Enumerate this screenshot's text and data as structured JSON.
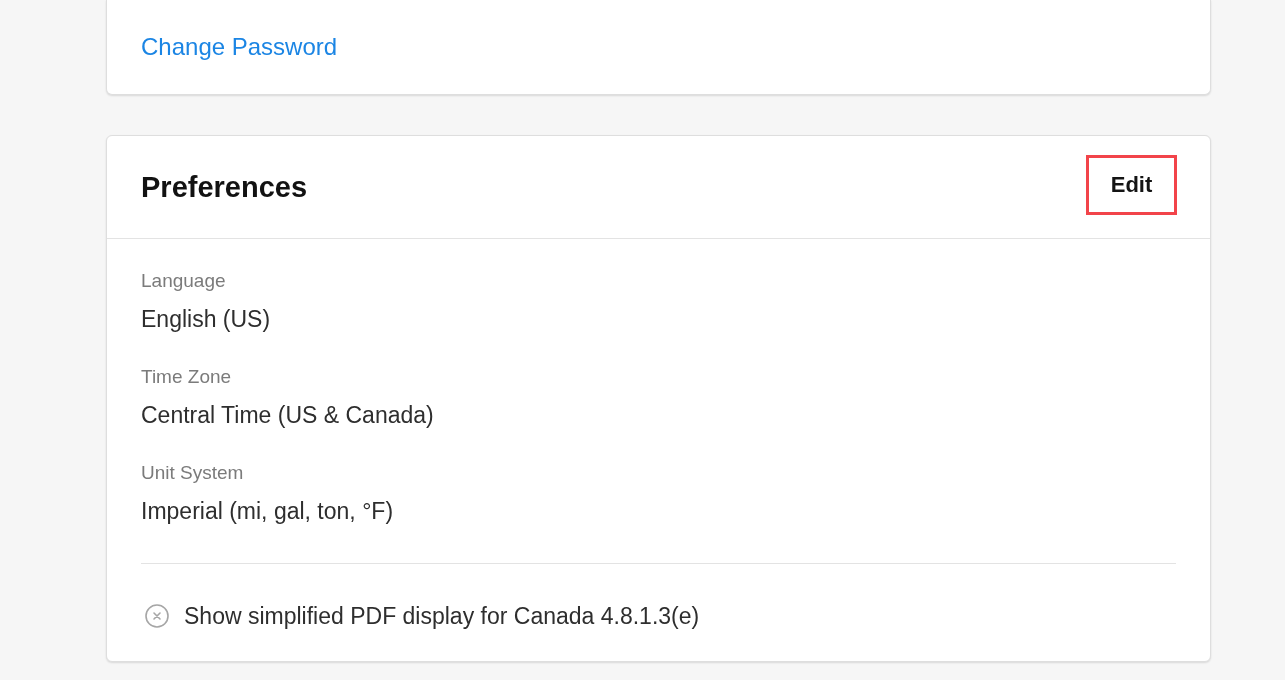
{
  "account_card": {
    "link": "Change Password"
  },
  "preferences": {
    "title": "Preferences",
    "edit_button": {
      "label": "Edit",
      "highlighted": true
    },
    "fields": [
      {
        "label": "Language",
        "value": "English (US)"
      },
      {
        "label": "Time Zone",
        "value": "Central Time (US & Canada)"
      },
      {
        "label": "Unit System",
        "value": "Imperial (mi, gal, ton, °F)"
      }
    ],
    "options": [
      {
        "label": "Show simplified PDF display for Canada 4.8.1.3(e)",
        "checked": false
      }
    ]
  }
}
